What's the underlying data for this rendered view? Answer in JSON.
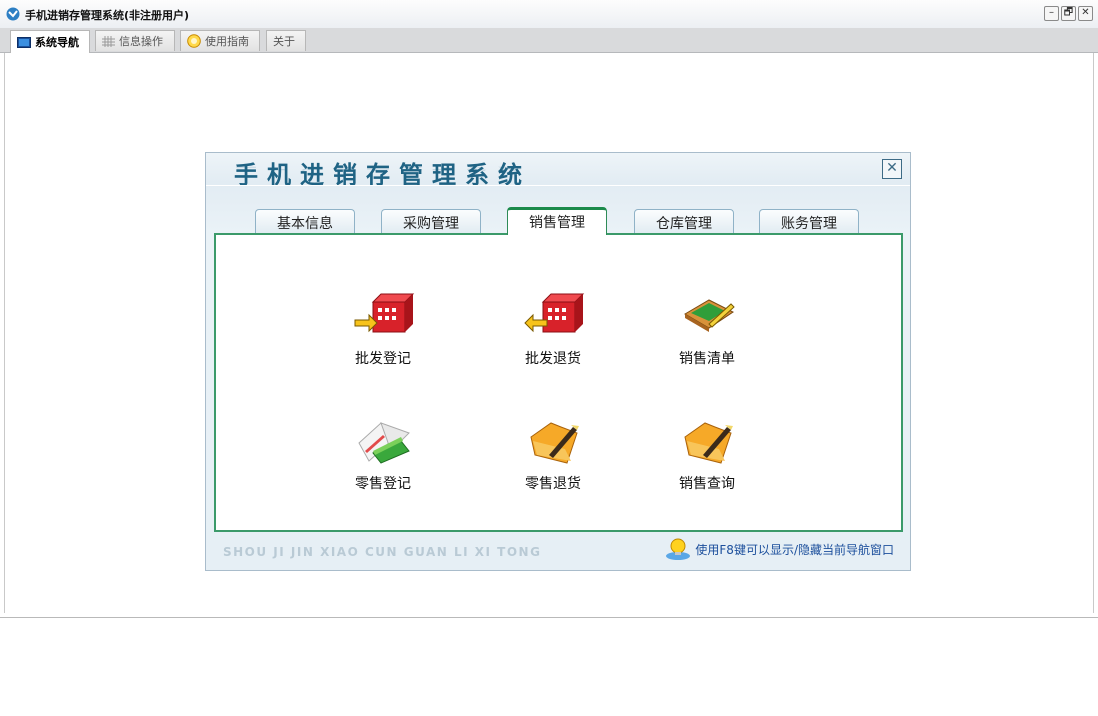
{
  "window": {
    "title": "手机进销存管理系统(非注册用户)",
    "buttons": [
      "–",
      "🗗",
      "✕"
    ]
  },
  "main_tabs": [
    {
      "label": "系统导航",
      "icon": "monitor-icon",
      "active": true
    },
    {
      "label": "信息操作",
      "icon": "grid-icon",
      "active": false
    },
    {
      "label": "使用指南",
      "icon": "help-icon",
      "active": false
    },
    {
      "label": "关于",
      "icon": "",
      "active": false
    }
  ],
  "nav": {
    "title": "手机进销存管理系统",
    "close_label": "✕",
    "tabs": [
      "基本信息",
      "采购管理",
      "销售管理",
      "仓库管理",
      "账务管理"
    ],
    "active_tab": "销售管理",
    "items": [
      {
        "label": "批发登记",
        "icon": "wholesale-register-icon"
      },
      {
        "label": "批发退货",
        "icon": "wholesale-return-icon"
      },
      {
        "label": "销售清单",
        "icon": "sales-list-icon"
      },
      {
        "label": "零售登记",
        "icon": "retail-register-icon"
      },
      {
        "label": "零售退货",
        "icon": "retail-return-icon"
      },
      {
        "label": "销售查询",
        "icon": "sales-query-icon"
      }
    ],
    "footer_pinyin": "SHOU JI JIN XIAO CUN GUAN LI XI TONG",
    "hint": "使用F8键可以显示/隐藏当前导航窗口"
  },
  "colors": {
    "title_blue": "#1f6384",
    "panel_border": "#3b9a6a",
    "hint_text": "#1c4f9c"
  }
}
